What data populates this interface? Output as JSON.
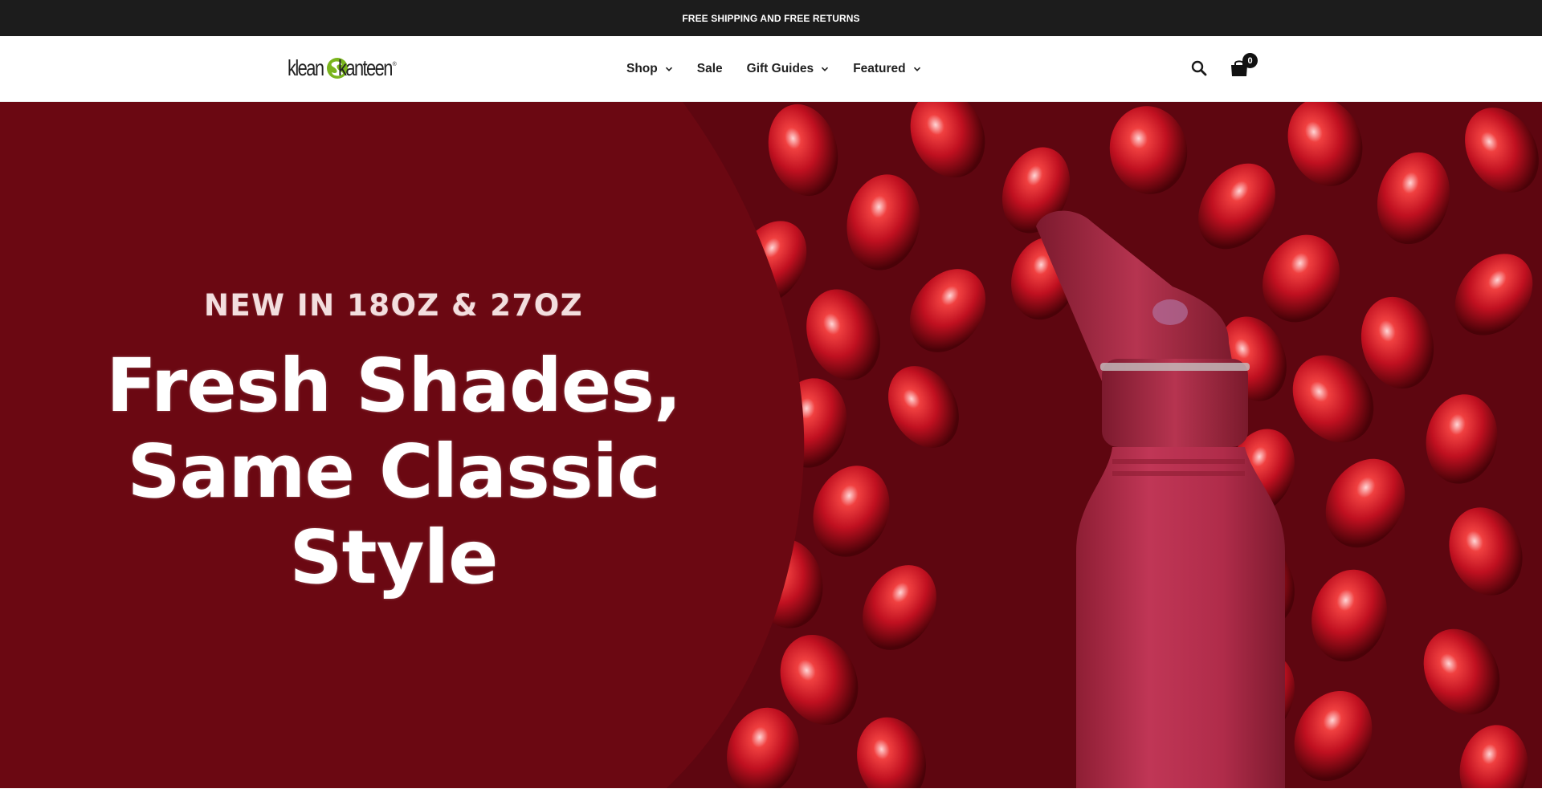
{
  "announcement": {
    "text": "FREE SHIPPING AND FREE RETURNS"
  },
  "header": {
    "logo": {
      "word1": "klean",
      "word2": "kanteen",
      "registered": "®",
      "mark_color": "#7ab51d"
    },
    "nav": [
      {
        "label": "Shop",
        "has_dropdown": true,
        "icon": "chevron-down-icon"
      },
      {
        "label": "Sale",
        "has_dropdown": false
      },
      {
        "label": "Gift Guides",
        "has_dropdown": true,
        "icon": "chevron-down-icon"
      },
      {
        "label": "Featured",
        "has_dropdown": true,
        "icon": "chevron-down-icon"
      }
    ],
    "search_icon": "search-icon",
    "cart": {
      "icon": "shopping-bag-icon",
      "count": "0"
    }
  },
  "hero": {
    "eyebrow": "NEW IN 18OZ & 27OZ",
    "title_lines": [
      "Fresh Shades,",
      "Same Classic",
      "Style"
    ],
    "panel_color": "#6b0812",
    "background_color": "#8a0c1a",
    "bottle_color": "#b52d49"
  },
  "colors": {
    "announcement_bg": "#1c1c1c",
    "text_dark": "#1f1f1f",
    "brand_green": "#7ab51d"
  }
}
